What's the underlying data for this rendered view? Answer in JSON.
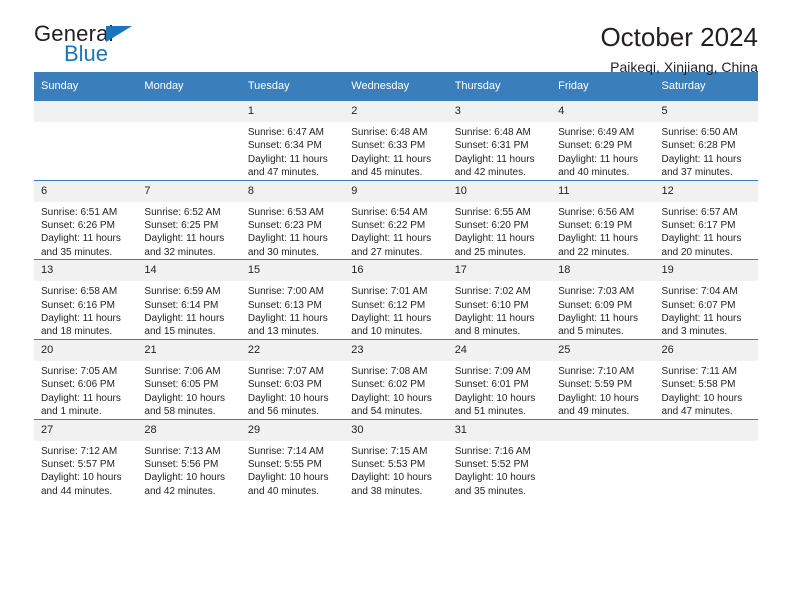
{
  "brand": {
    "name_primary": "General",
    "name_secondary": "Blue"
  },
  "header": {
    "title": "October 2024",
    "location": "Paikeqi, Xinjiang, China"
  },
  "colors": {
    "header_blue": "#3b7ebc",
    "brand_blue": "#1b75bb",
    "daynum_band": "#f1f1f1",
    "text": "#231f20"
  },
  "calendar": {
    "weekday_headers": [
      "Sunday",
      "Monday",
      "Tuesday",
      "Wednesday",
      "Thursday",
      "Friday",
      "Saturday"
    ],
    "labels": {
      "sunrise": "Sunrise:",
      "sunset": "Sunset:",
      "daylight": "Daylight:"
    },
    "weeks": [
      [
        {
          "day": "",
          "sunrise": "",
          "sunset": "",
          "daylight_line1": "",
          "daylight_line2": "",
          "blank": true
        },
        {
          "day": "",
          "sunrise": "",
          "sunset": "",
          "daylight_line1": "",
          "daylight_line2": "",
          "blank": true
        },
        {
          "day": "1",
          "sunrise": "Sunrise: 6:47 AM",
          "sunset": "Sunset: 6:34 PM",
          "daylight_line1": "Daylight: 11 hours",
          "daylight_line2": "and 47 minutes."
        },
        {
          "day": "2",
          "sunrise": "Sunrise: 6:48 AM",
          "sunset": "Sunset: 6:33 PM",
          "daylight_line1": "Daylight: 11 hours",
          "daylight_line2": "and 45 minutes."
        },
        {
          "day": "3",
          "sunrise": "Sunrise: 6:48 AM",
          "sunset": "Sunset: 6:31 PM",
          "daylight_line1": "Daylight: 11 hours",
          "daylight_line2": "and 42 minutes."
        },
        {
          "day": "4",
          "sunrise": "Sunrise: 6:49 AM",
          "sunset": "Sunset: 6:29 PM",
          "daylight_line1": "Daylight: 11 hours",
          "daylight_line2": "and 40 minutes."
        },
        {
          "day": "5",
          "sunrise": "Sunrise: 6:50 AM",
          "sunset": "Sunset: 6:28 PM",
          "daylight_line1": "Daylight: 11 hours",
          "daylight_line2": "and 37 minutes."
        }
      ],
      [
        {
          "day": "6",
          "sunrise": "Sunrise: 6:51 AM",
          "sunset": "Sunset: 6:26 PM",
          "daylight_line1": "Daylight: 11 hours",
          "daylight_line2": "and 35 minutes."
        },
        {
          "day": "7",
          "sunrise": "Sunrise: 6:52 AM",
          "sunset": "Sunset: 6:25 PM",
          "daylight_line1": "Daylight: 11 hours",
          "daylight_line2": "and 32 minutes."
        },
        {
          "day": "8",
          "sunrise": "Sunrise: 6:53 AM",
          "sunset": "Sunset: 6:23 PM",
          "daylight_line1": "Daylight: 11 hours",
          "daylight_line2": "and 30 minutes."
        },
        {
          "day": "9",
          "sunrise": "Sunrise: 6:54 AM",
          "sunset": "Sunset: 6:22 PM",
          "daylight_line1": "Daylight: 11 hours",
          "daylight_line2": "and 27 minutes."
        },
        {
          "day": "10",
          "sunrise": "Sunrise: 6:55 AM",
          "sunset": "Sunset: 6:20 PM",
          "daylight_line1": "Daylight: 11 hours",
          "daylight_line2": "and 25 minutes."
        },
        {
          "day": "11",
          "sunrise": "Sunrise: 6:56 AM",
          "sunset": "Sunset: 6:19 PM",
          "daylight_line1": "Daylight: 11 hours",
          "daylight_line2": "and 22 minutes."
        },
        {
          "day": "12",
          "sunrise": "Sunrise: 6:57 AM",
          "sunset": "Sunset: 6:17 PM",
          "daylight_line1": "Daylight: 11 hours",
          "daylight_line2": "and 20 minutes."
        }
      ],
      [
        {
          "day": "13",
          "sunrise": "Sunrise: 6:58 AM",
          "sunset": "Sunset: 6:16 PM",
          "daylight_line1": "Daylight: 11 hours",
          "daylight_line2": "and 18 minutes."
        },
        {
          "day": "14",
          "sunrise": "Sunrise: 6:59 AM",
          "sunset": "Sunset: 6:14 PM",
          "daylight_line1": "Daylight: 11 hours",
          "daylight_line2": "and 15 minutes."
        },
        {
          "day": "15",
          "sunrise": "Sunrise: 7:00 AM",
          "sunset": "Sunset: 6:13 PM",
          "daylight_line1": "Daylight: 11 hours",
          "daylight_line2": "and 13 minutes."
        },
        {
          "day": "16",
          "sunrise": "Sunrise: 7:01 AM",
          "sunset": "Sunset: 6:12 PM",
          "daylight_line1": "Daylight: 11 hours",
          "daylight_line2": "and 10 minutes."
        },
        {
          "day": "17",
          "sunrise": "Sunrise: 7:02 AM",
          "sunset": "Sunset: 6:10 PM",
          "daylight_line1": "Daylight: 11 hours",
          "daylight_line2": "and 8 minutes."
        },
        {
          "day": "18",
          "sunrise": "Sunrise: 7:03 AM",
          "sunset": "Sunset: 6:09 PM",
          "daylight_line1": "Daylight: 11 hours",
          "daylight_line2": "and 5 minutes."
        },
        {
          "day": "19",
          "sunrise": "Sunrise: 7:04 AM",
          "sunset": "Sunset: 6:07 PM",
          "daylight_line1": "Daylight: 11 hours",
          "daylight_line2": "and 3 minutes."
        }
      ],
      [
        {
          "day": "20",
          "sunrise": "Sunrise: 7:05 AM",
          "sunset": "Sunset: 6:06 PM",
          "daylight_line1": "Daylight: 11 hours",
          "daylight_line2": "and 1 minute."
        },
        {
          "day": "21",
          "sunrise": "Sunrise: 7:06 AM",
          "sunset": "Sunset: 6:05 PM",
          "daylight_line1": "Daylight: 10 hours",
          "daylight_line2": "and 58 minutes."
        },
        {
          "day": "22",
          "sunrise": "Sunrise: 7:07 AM",
          "sunset": "Sunset: 6:03 PM",
          "daylight_line1": "Daylight: 10 hours",
          "daylight_line2": "and 56 minutes."
        },
        {
          "day": "23",
          "sunrise": "Sunrise: 7:08 AM",
          "sunset": "Sunset: 6:02 PM",
          "daylight_line1": "Daylight: 10 hours",
          "daylight_line2": "and 54 minutes."
        },
        {
          "day": "24",
          "sunrise": "Sunrise: 7:09 AM",
          "sunset": "Sunset: 6:01 PM",
          "daylight_line1": "Daylight: 10 hours",
          "daylight_line2": "and 51 minutes."
        },
        {
          "day": "25",
          "sunrise": "Sunrise: 7:10 AM",
          "sunset": "Sunset: 5:59 PM",
          "daylight_line1": "Daylight: 10 hours",
          "daylight_line2": "and 49 minutes."
        },
        {
          "day": "26",
          "sunrise": "Sunrise: 7:11 AM",
          "sunset": "Sunset: 5:58 PM",
          "daylight_line1": "Daylight: 10 hours",
          "daylight_line2": "and 47 minutes."
        }
      ],
      [
        {
          "day": "27",
          "sunrise": "Sunrise: 7:12 AM",
          "sunset": "Sunset: 5:57 PM",
          "daylight_line1": "Daylight: 10 hours",
          "daylight_line2": "and 44 minutes."
        },
        {
          "day": "28",
          "sunrise": "Sunrise: 7:13 AM",
          "sunset": "Sunset: 5:56 PM",
          "daylight_line1": "Daylight: 10 hours",
          "daylight_line2": "and 42 minutes."
        },
        {
          "day": "29",
          "sunrise": "Sunrise: 7:14 AM",
          "sunset": "Sunset: 5:55 PM",
          "daylight_line1": "Daylight: 10 hours",
          "daylight_line2": "and 40 minutes."
        },
        {
          "day": "30",
          "sunrise": "Sunrise: 7:15 AM",
          "sunset": "Sunset: 5:53 PM",
          "daylight_line1": "Daylight: 10 hours",
          "daylight_line2": "and 38 minutes."
        },
        {
          "day": "31",
          "sunrise": "Sunrise: 7:16 AM",
          "sunset": "Sunset: 5:52 PM",
          "daylight_line1": "Daylight: 10 hours",
          "daylight_line2": "and 35 minutes."
        },
        {
          "day": "",
          "sunrise": "",
          "sunset": "",
          "daylight_line1": "",
          "daylight_line2": "",
          "blank": true
        },
        {
          "day": "",
          "sunrise": "",
          "sunset": "",
          "daylight_line1": "",
          "daylight_line2": "",
          "blank": true
        }
      ]
    ]
  }
}
